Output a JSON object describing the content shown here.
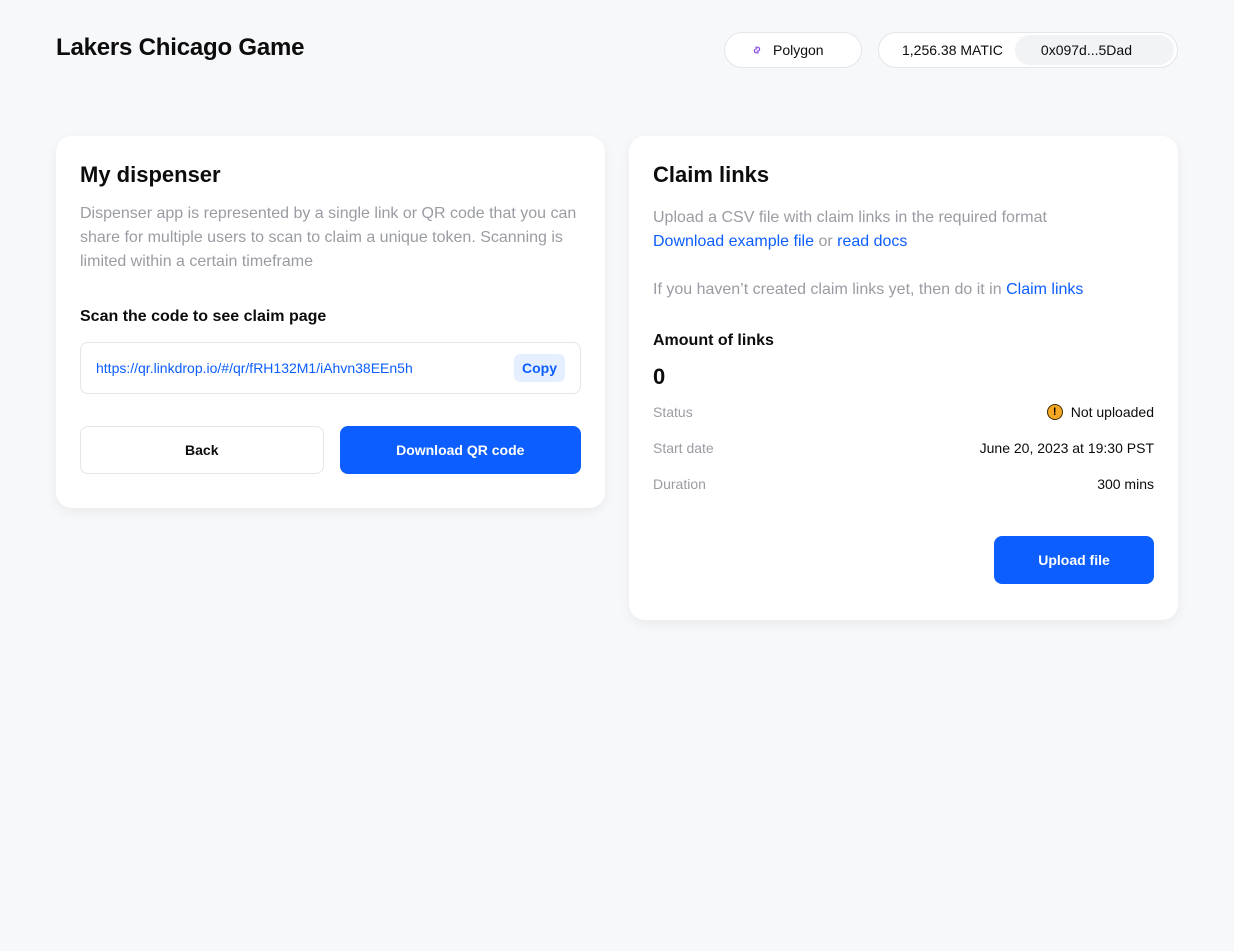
{
  "header": {
    "title": "Lakers Chicago Game",
    "network": {
      "label": "Polygon",
      "icon": "chain-link-icon"
    },
    "wallet": {
      "balance": "1,256.38 MATIC",
      "address": "0x097d...5Dad"
    }
  },
  "dispenser": {
    "title": "My dispenser",
    "description": "Dispenser app is represented by a single link or QR code that you can share for multiple users to scan to claim a unique token. Scanning is limited within a certain timeframe",
    "scan_label": "Scan the code to see claim page",
    "url": "https://qr.linkdrop.io/#/qr/fRH132M1/iAhvn38EEn5h",
    "copy_label": "Copy",
    "back_label": "Back",
    "download_label": "Download QR code"
  },
  "claim_links": {
    "title": "Claim links",
    "upload_text": "Upload a CSV file with claim links in the required format",
    "download_example": "Download example file",
    "or_text": "or",
    "read_docs": "read docs",
    "not_created_text": "If you haven’t created claim links yet, then do it in",
    "claim_links_link": "Claim links",
    "amount_label": "Amount of links",
    "amount_value": "0",
    "status_label": "Status",
    "status_value": "Not uploaded",
    "status_icon": "warning-icon",
    "start_date_label": "Start date",
    "start_date_value": "June 20, 2023 at 19:30 PST",
    "duration_label": "Duration",
    "duration_value": "300 mins",
    "upload_label": "Upload file"
  },
  "colors": {
    "accent": "#0C5EFF",
    "status_error": "#F24E4E",
    "warning": "#F5A623",
    "background": "#F7F8FA",
    "muted_text": "#9A9CA3"
  }
}
